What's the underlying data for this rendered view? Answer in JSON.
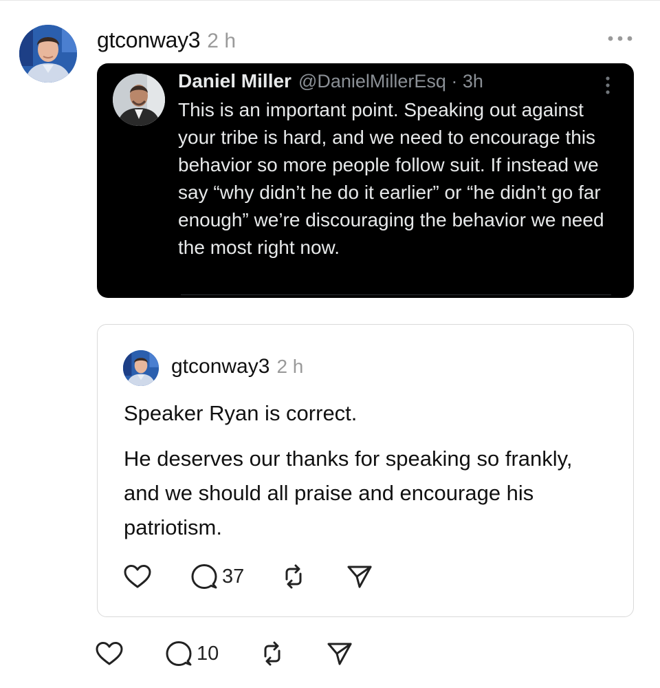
{
  "post": {
    "username": "gtconway3",
    "time": "2 h",
    "more_icon": "more-horizontal-icon",
    "embedded_tweet": {
      "display_name": "Daniel Miller",
      "handle_time": "@DanielMillerEsq · 3h",
      "text": "This is an important point. Speaking out against your tribe is hard, and we need to encourage this behavior so more people follow suit. If instead we say “why didn’t he do it earlier” or “he didn’t go far enough” we’re discouraging the behavior we need the most right now."
    },
    "quoted_post": {
      "username": "gtconway3",
      "time": "2 h",
      "paragraphs": [
        "Speaker Ryan is correct.",
        "He deserves our thanks for speaking so frankly, and we should all praise and encourage his patriotism."
      ],
      "actions": {
        "like_icon": "heart-icon",
        "reply_icon": "comment-icon",
        "reply_count": "37",
        "repost_icon": "repost-icon",
        "share_icon": "send-icon"
      }
    },
    "actions": {
      "like_icon": "heart-icon",
      "reply_icon": "comment-icon",
      "reply_count": "10",
      "repost_icon": "repost-icon",
      "share_icon": "send-icon"
    }
  },
  "colors": {
    "text": "#111111",
    "muted": "#9a9a9a",
    "embed_bg": "#000000",
    "embed_text": "#e7e9ea",
    "embed_handle": "#8b9096",
    "card_border": "#d9d9d9"
  }
}
